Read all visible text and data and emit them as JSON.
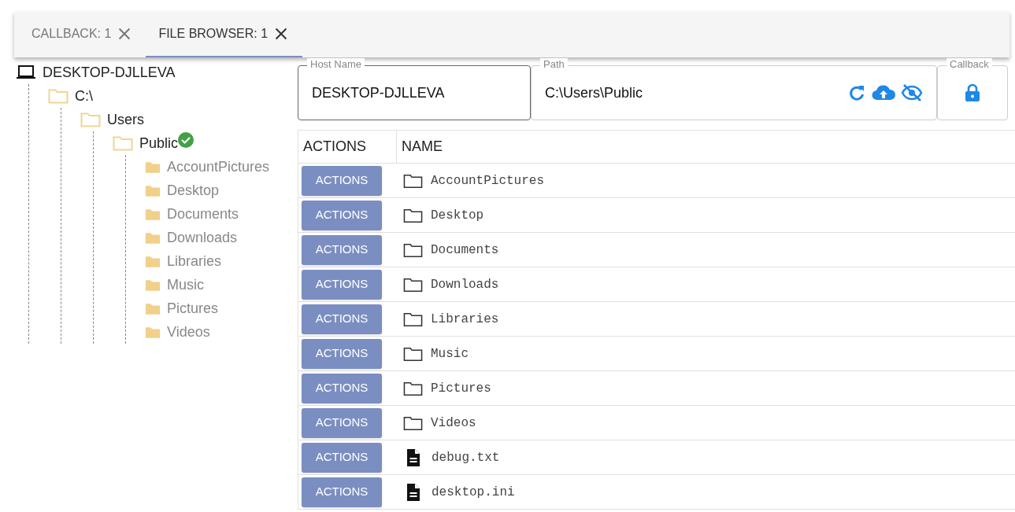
{
  "tabs": [
    {
      "label": "CALLBACK: 1",
      "selected": false
    },
    {
      "label": "FILE BROWSER: 1",
      "selected": true
    }
  ],
  "tree": {
    "label": "DESKTOP-DJLLEVA",
    "kind": "computer",
    "children": [
      {
        "label": "C:\\",
        "kind": "folder",
        "expanded": true,
        "selected": false,
        "children": [
          {
            "label": "Users",
            "kind": "folder",
            "expanded": true,
            "selected": false,
            "children": [
              {
                "label": "Public",
                "kind": "folder",
                "expanded": true,
                "selected": true,
                "children": [
                  {
                    "label": "AccountPictures",
                    "kind": "folder",
                    "expanded": false,
                    "selected": false
                  },
                  {
                    "label": "Desktop",
                    "kind": "folder",
                    "expanded": false,
                    "selected": false
                  },
                  {
                    "label": "Documents",
                    "kind": "folder",
                    "expanded": false,
                    "selected": false
                  },
                  {
                    "label": "Downloads",
                    "kind": "folder",
                    "expanded": false,
                    "selected": false
                  },
                  {
                    "label": "Libraries",
                    "kind": "folder",
                    "expanded": false,
                    "selected": false
                  },
                  {
                    "label": "Music",
                    "kind": "folder",
                    "expanded": false,
                    "selected": false
                  },
                  {
                    "label": "Pictures",
                    "kind": "folder",
                    "expanded": false,
                    "selected": false
                  },
                  {
                    "label": "Videos",
                    "kind": "folder",
                    "expanded": false,
                    "selected": false
                  }
                ]
              }
            ]
          }
        ]
      }
    ]
  },
  "fields": [
    {
      "label": "Host Name",
      "value": "DESKTOP-DJLLEVA",
      "kind": "text"
    },
    {
      "label": "Path",
      "value": "C:\\Users\\Public",
      "kind": "path"
    },
    {
      "label": "Callback",
      "kind": "lock"
    }
  ],
  "table": {
    "columns": [
      "ACTIONS",
      "NAME"
    ],
    "rows": [
      {
        "action": "ACTIONS",
        "kind": "folder",
        "name": "AccountPictures"
      },
      {
        "action": "ACTIONS",
        "kind": "folder",
        "name": "Desktop"
      },
      {
        "action": "ACTIONS",
        "kind": "folder",
        "name": "Documents"
      },
      {
        "action": "ACTIONS",
        "kind": "folder",
        "name": "Downloads"
      },
      {
        "action": "ACTIONS",
        "kind": "folder",
        "name": "Libraries"
      },
      {
        "action": "ACTIONS",
        "kind": "folder",
        "name": "Music"
      },
      {
        "action": "ACTIONS",
        "kind": "folder",
        "name": "Pictures"
      },
      {
        "action": "ACTIONS",
        "kind": "folder",
        "name": "Videos"
      },
      {
        "action": "ACTIONS",
        "kind": "file",
        "name": "debug.txt"
      },
      {
        "action": "ACTIONS",
        "kind": "file",
        "name": "desktop.ini"
      }
    ]
  }
}
